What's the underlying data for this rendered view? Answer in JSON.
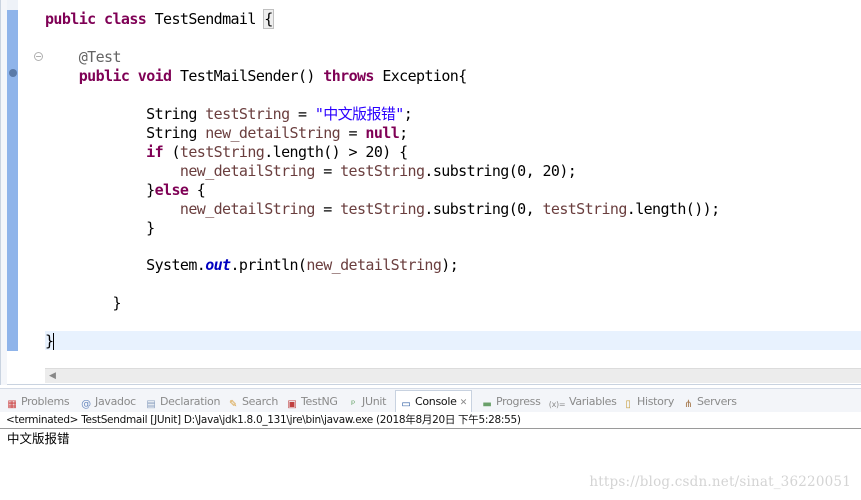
{
  "editor": {
    "lines": [
      {
        "top": 0,
        "indent": 0,
        "tokens": [
          [
            "kw",
            "public"
          ],
          [
            "",
            ""
          ],
          [
            "kw",
            " class"
          ],
          [
            "",
            " TestSendmail {"
          ]
        ]
      },
      {
        "tokens": []
      }
    ],
    "code": {
      "l1": {
        "kw1": "public",
        "kw2": "class",
        "name": "TestSendmail",
        "brace": "{"
      },
      "l2": {
        "annotation": "@Test"
      },
      "l3": {
        "kw1": "public",
        "kw2": "void",
        "name": "TestMailSender()",
        "kw3": "throws",
        "type": "Exception{"
      },
      "l4": {
        "type": "String",
        "var": "testString",
        "eq": " = ",
        "str": "\"中文版报错\"",
        "end": ";"
      },
      "l5": {
        "type": "String",
        "var": "new_detailString",
        "eq": " = ",
        "kw": "null",
        "end": ";"
      },
      "l6": {
        "kw": "if",
        "open": " (",
        "var": "testString",
        "rest": ".length() > 20) {"
      },
      "l7": {
        "var1": "new_detailString",
        "eq": " = ",
        "var2": "testString",
        "rest": ".substring(0, 20);"
      },
      "l8": {
        "brace": "}",
        "kw": "else",
        "rest": " {"
      },
      "l9": {
        "var1": "new_detailString",
        "eq": " = ",
        "var2": "testString",
        "mid": ".substring(0, ",
        "var3": "testString",
        "rest": ".length());"
      },
      "l10": {
        "brace": "}"
      },
      "l11": {
        "cls": "System.",
        "field": "out",
        "mid": ".println(",
        "var": "new_detailString",
        "end": ");"
      },
      "l12": {
        "brace": "}"
      },
      "l13": {
        "brace": "}"
      }
    }
  },
  "panel": {
    "tabs": [
      {
        "label": "Problems",
        "icon": "problems-icon",
        "glyph": "▦"
      },
      {
        "label": "Javadoc",
        "icon": "javadoc-icon",
        "glyph": "@"
      },
      {
        "label": "Declaration",
        "icon": "declaration-icon",
        "glyph": "▤"
      },
      {
        "label": "Search",
        "icon": "search-icon",
        "glyph": "✎"
      },
      {
        "label": "TestNG",
        "icon": "testng-icon",
        "glyph": "▣"
      },
      {
        "label": "JUnit",
        "icon": "junit-icon",
        "glyph": "ᵖ"
      },
      {
        "label": "Console",
        "icon": "console-icon",
        "glyph": "▭",
        "close": "✕",
        "active": true
      },
      {
        "label": "Progress",
        "icon": "progress-icon",
        "glyph": "▬"
      },
      {
        "label": "Variables",
        "icon": "variables-icon",
        "glyph": "⁽ˣ⁾="
      },
      {
        "label": "History",
        "icon": "history-icon",
        "glyph": "▯"
      },
      {
        "label": "Servers",
        "icon": "servers-icon",
        "glyph": "⋔"
      }
    ],
    "status": "<terminated> TestSendmail [JUnit] D:\\Java\\jdk1.8.0_131\\jre\\bin\\javaw.exe (2018年8月20日 下午5:28:55)",
    "output": "中文版报错"
  },
  "watermark": "https://blog.csdn.net/sinat_36220051",
  "colors": {
    "keyword": "#7f0055",
    "string": "#2a00ff",
    "variable": "#6a3e3e",
    "field": "#0000c0",
    "annotation": "#646464",
    "current_line": "#e8f2fe",
    "ruler": "#8fb4ea"
  }
}
